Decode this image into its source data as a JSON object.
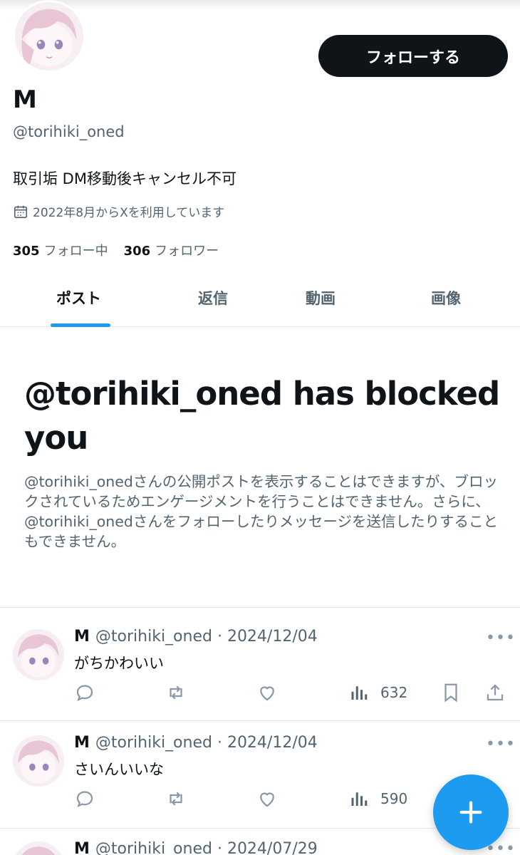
{
  "profile": {
    "follow_label": "フォローする",
    "display_name": "M",
    "handle": "@torihiki_oned",
    "bio": "取引垢 DM移動後キャンセル不可",
    "joined": "2022年8月からXを利用しています",
    "following_count": "305",
    "following_label": "フォロー中",
    "followers_count": "306",
    "followers_label": "フォロワー"
  },
  "tabs": [
    "ポスト",
    "返信",
    "動画",
    "画像"
  ],
  "blocked": {
    "title": "@torihiki_oned has blocked you",
    "body": "@torihiki_onedさんの公開ポストを表示することはできますが、ブロックされているためエンゲージメントを行うことはできません。さらに、@torihiki_onedさんをフォローしたりメッセージを送信したりすることもできません。"
  },
  "posts": [
    {
      "name": "M",
      "meta": "@torihiki_oned · 2024/12/04",
      "text": "がちかわいい",
      "views": "632"
    },
    {
      "name": "M",
      "meta": "@torihiki_oned · 2024/12/04",
      "text": "さいんいいな",
      "views": "590"
    },
    {
      "name": "M",
      "meta": "@torihiki_oned · 2024/07/29"
    }
  ],
  "more_label": "•••",
  "icons": [
    "calendar-icon",
    "reply-icon",
    "repost-icon",
    "like-icon",
    "views-icon",
    "bookmark-icon",
    "share-icon",
    "compose-icon"
  ],
  "colors": {
    "accent": "#1d9bf0",
    "text": "#0f1419",
    "muted": "#536471",
    "icon": "#8b98a5"
  }
}
